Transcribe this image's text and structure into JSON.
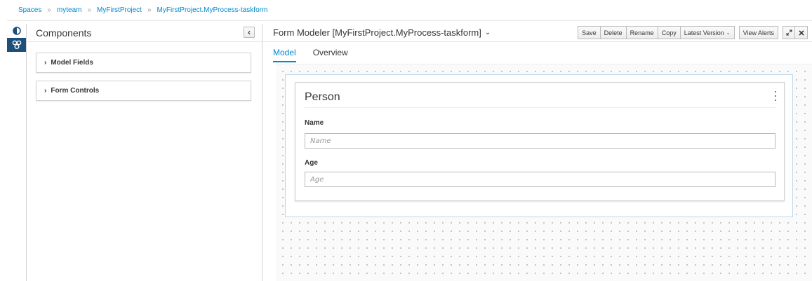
{
  "breadcrumb": {
    "items": [
      "Spaces",
      "myteam",
      "MyFirstProject",
      "MyFirstProject.MyProcess-taskform"
    ],
    "separator": "»"
  },
  "rail": {
    "icons": [
      "half-circle-icon",
      "group-icon"
    ]
  },
  "components": {
    "title": "Components",
    "collapse_glyph": "‹",
    "sections": [
      {
        "label": "Model Fields"
      },
      {
        "label": "Form Controls"
      }
    ]
  },
  "editor": {
    "title": "Form Modeler [MyFirstProject.MyProcess-taskform]",
    "toolbar": {
      "save": "Save",
      "delete": "Delete",
      "rename": "Rename",
      "copy": "Copy",
      "version": "Latest Version",
      "view_alerts": "View Alerts"
    },
    "tabs": [
      {
        "label": "Model"
      },
      {
        "label": "Overview"
      }
    ]
  },
  "form": {
    "title": "Person",
    "fields": [
      {
        "label": "Name",
        "placeholder": "Name",
        "value": ""
      },
      {
        "label": "Age",
        "placeholder": "Age",
        "value": ""
      }
    ]
  },
  "colors": {
    "accent": "#0088ce",
    "rail_active": "#1c4f7a"
  }
}
